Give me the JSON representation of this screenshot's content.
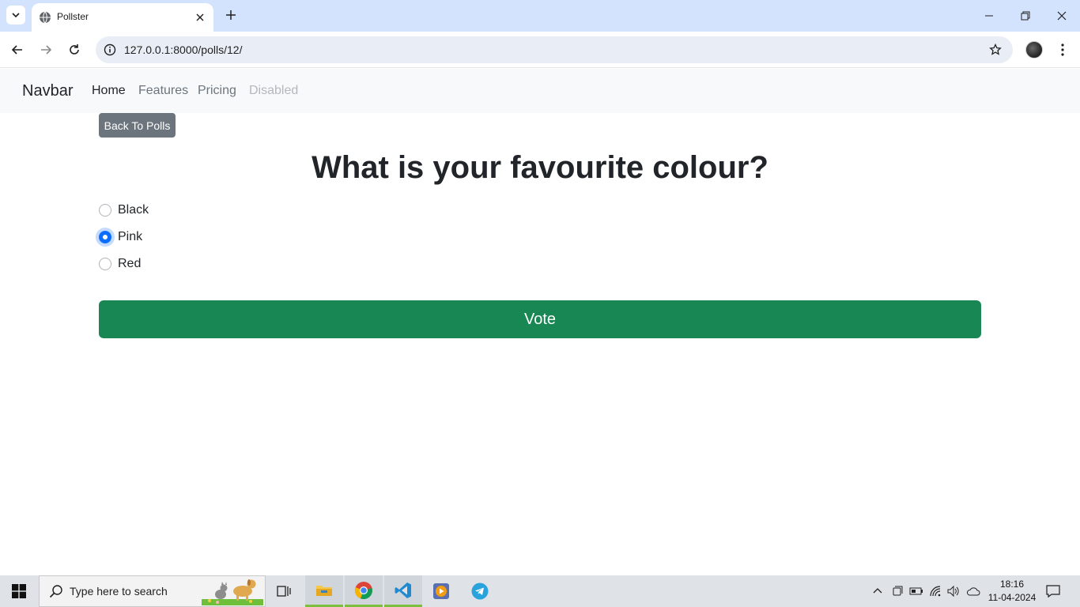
{
  "browser": {
    "tab_title": "Pollster",
    "url": "127.0.0.1:8000/polls/12/"
  },
  "navbar": {
    "brand": "Navbar",
    "links": [
      {
        "label": "Home",
        "state": "active"
      },
      {
        "label": "Features",
        "state": "normal"
      },
      {
        "label": "Pricing",
        "state": "normal"
      },
      {
        "label": "Disabled",
        "state": "disabled"
      }
    ]
  },
  "page": {
    "back_button": "Back To Polls",
    "question": "What is your favourite colour?",
    "choices": [
      {
        "label": "Black",
        "selected": false
      },
      {
        "label": "Pink",
        "selected": true
      },
      {
        "label": "Red",
        "selected": false
      }
    ],
    "vote_button": "Vote"
  },
  "taskbar": {
    "search_placeholder": "Type here to search",
    "time": "18:16",
    "date": "11-04-2024"
  },
  "colors": {
    "vote": "#198754",
    "back": "#6c757d",
    "radio_checked": "#0d6efd",
    "tabstrip": "#d3e3fd"
  }
}
